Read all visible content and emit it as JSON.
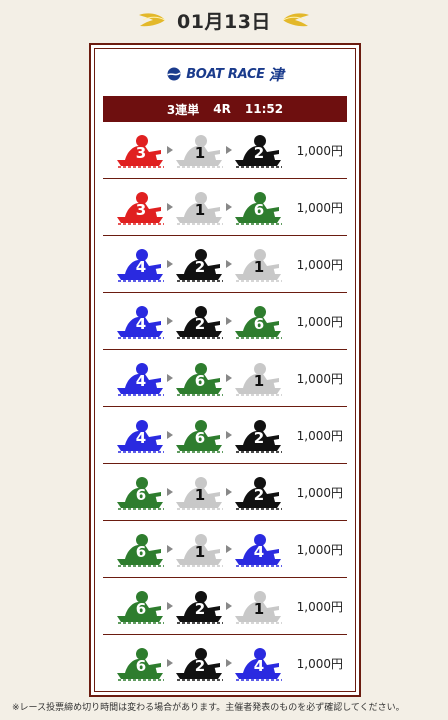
{
  "header": {
    "date": "01月13日",
    "left_icon": "laurel-wing-icon",
    "right_icon": "laurel-wing-icon"
  },
  "logo": {
    "text": "BOAT RACE",
    "kanji": "津"
  },
  "race": {
    "bet_type": "3連単",
    "race_no": "4R",
    "time": "11:52"
  },
  "boat_colors": {
    "1": {
      "fill": "#c8c8c8",
      "num": "#111111"
    },
    "2": {
      "fill": "#111111",
      "num": "#ffffff"
    },
    "3": {
      "fill": "#e02020",
      "num": "#ffffff"
    },
    "4": {
      "fill": "#2a2ae0",
      "num": "#ffffff"
    },
    "6": {
      "fill": "#2e7d2e",
      "num": "#ffffff"
    }
  },
  "rows": [
    {
      "boats": [
        "3",
        "1",
        "2"
      ],
      "price": "1,000円"
    },
    {
      "boats": [
        "3",
        "1",
        "6"
      ],
      "price": "1,000円"
    },
    {
      "boats": [
        "4",
        "2",
        "1"
      ],
      "price": "1,000円"
    },
    {
      "boats": [
        "4",
        "2",
        "6"
      ],
      "price": "1,000円"
    },
    {
      "boats": [
        "4",
        "6",
        "1"
      ],
      "price": "1,000円"
    },
    {
      "boats": [
        "4",
        "6",
        "2"
      ],
      "price": "1,000円"
    },
    {
      "boats": [
        "6",
        "1",
        "2"
      ],
      "price": "1,000円"
    },
    {
      "boats": [
        "6",
        "1",
        "4"
      ],
      "price": "1,000円"
    },
    {
      "boats": [
        "6",
        "2",
        "1"
      ],
      "price": "1,000円"
    },
    {
      "boats": [
        "6",
        "2",
        "4"
      ],
      "price": "1,000円"
    }
  ],
  "footnote": "※レース投票締め切り時間は変わる場合があります。主催者発表のものを必ず確認してください。"
}
